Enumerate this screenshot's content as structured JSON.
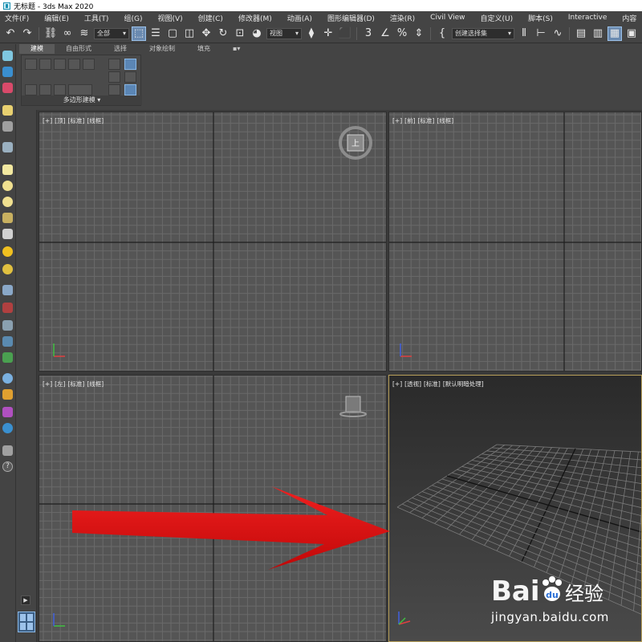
{
  "window": {
    "title": "无标题 - 3ds Max 2020"
  },
  "menu": {
    "items": [
      "文件(F)",
      "编辑(E)",
      "工具(T)",
      "组(G)",
      "视图(V)",
      "创建(C)",
      "修改器(M)",
      "动画(A)",
      "图形编辑器(D)",
      "渲染(R)",
      "Civil View",
      "自定义(U)",
      "脚本(S)",
      "Interactive",
      "内容"
    ]
  },
  "toolbar": {
    "filter_value": "全部",
    "refcoord_value": "视图",
    "selection_set_placeholder": "创建选择集"
  },
  "ribbon": {
    "tabs": [
      "建模",
      "自由形式",
      "选择",
      "对象绘制",
      "填充"
    ],
    "active_tab": "建模",
    "panel_label": "多边形建模"
  },
  "viewports": {
    "top": [
      "[+]",
      "[顶]",
      "[标准]",
      "[线框]"
    ],
    "front": [
      "[+]",
      "[前]",
      "[标准]",
      "[线框]"
    ],
    "left": [
      "[+]",
      "[左]",
      "[标准]",
      "[线框]"
    ],
    "perspective": [
      "[+]",
      "[透视]",
      "[标准]",
      "[默认明暗处理]"
    ]
  },
  "viewcube": {
    "top_face": "上"
  },
  "watermark": {
    "logo": "Bai 经验",
    "url": "jingyan.baidu.com"
  },
  "colors": {
    "viewport_bg": "#555555",
    "grid_line": "#6a6a6a",
    "axis_line": "#1e1e1e",
    "active_border": "#b8a05a",
    "arrow": "#e01515"
  }
}
